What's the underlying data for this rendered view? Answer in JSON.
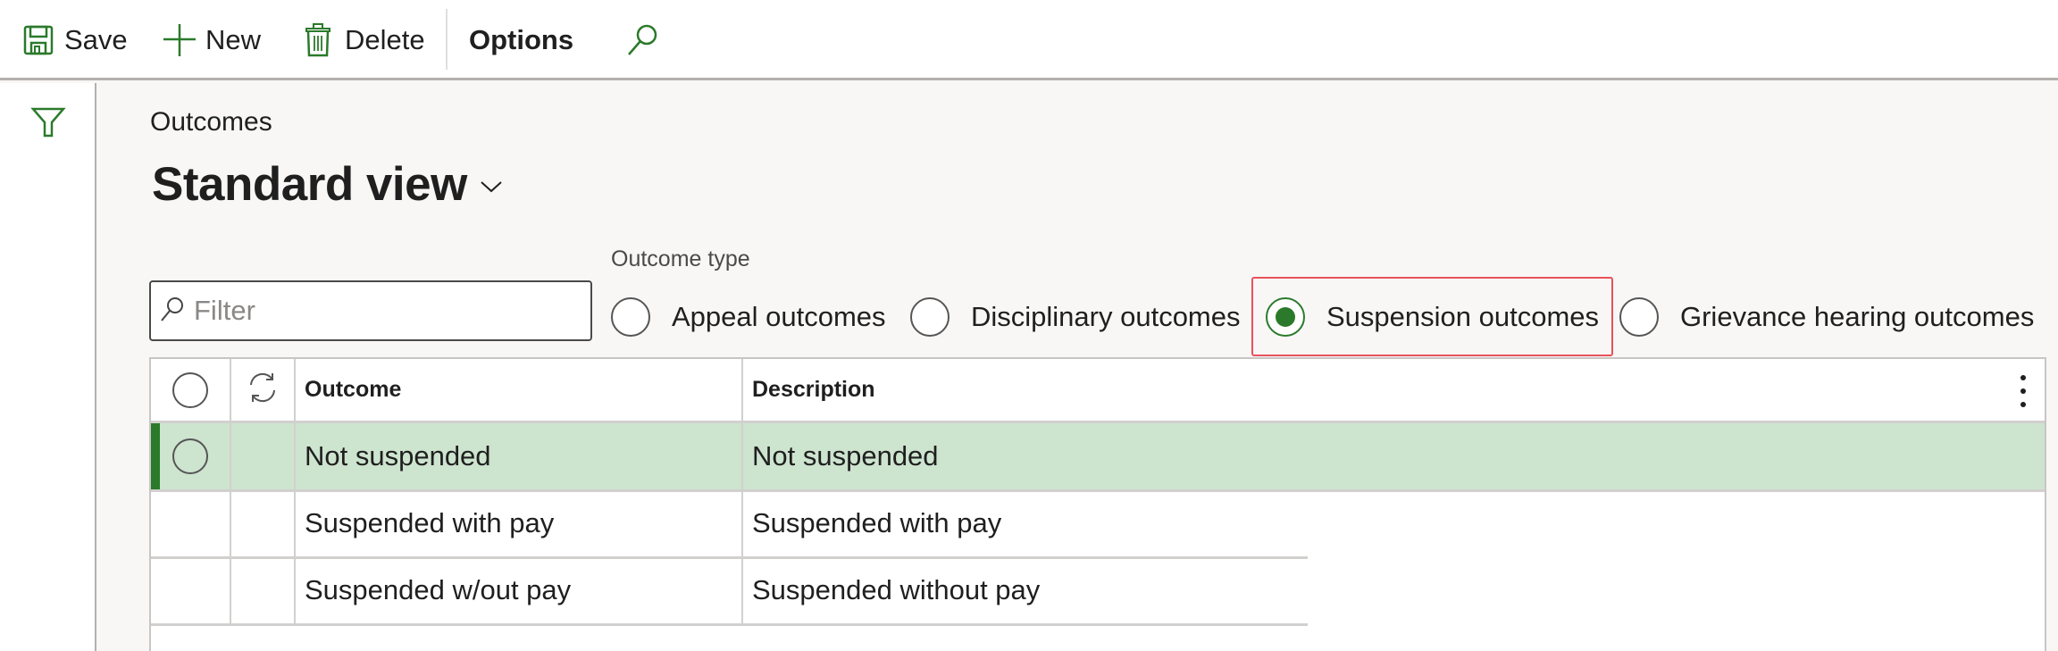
{
  "toolbar": {
    "save_label": "Save",
    "new_label": "New",
    "delete_label": "Delete",
    "options_label": "Options",
    "icons": {
      "save": "save-icon",
      "new": "plus-icon",
      "delete": "trash-icon",
      "search": "search-icon"
    }
  },
  "left_pane": {
    "filter_icon": "filter-icon"
  },
  "header": {
    "breadcrumb": "Outcomes",
    "view_title": "Standard view"
  },
  "filter": {
    "placeholder": "Filter",
    "value": ""
  },
  "outcome_type": {
    "label": "Outcome type",
    "options": [
      {
        "label": "Appeal outcomes",
        "checked": false
      },
      {
        "label": "Disciplinary outcomes",
        "checked": false
      },
      {
        "label": "Suspension outcomes",
        "checked": true
      },
      {
        "label": "Grievance hearing outcomes",
        "checked": false
      }
    ],
    "selected": "Suspension outcomes"
  },
  "grid": {
    "columns": [
      "Outcome",
      "Description"
    ],
    "rows": [
      {
        "outcome": "Not suspended",
        "description": "Not suspended",
        "selected": true
      },
      {
        "outcome": "Suspended with pay",
        "description": "Suspended with pay",
        "selected": false
      },
      {
        "outcome": "Suspended w/out pay",
        "description": "Suspended without pay",
        "selected": false
      }
    ]
  },
  "colors": {
    "accent": "#2b7a2b",
    "selected_row": "#cde4cf",
    "highlight_box": "#e8525b"
  }
}
